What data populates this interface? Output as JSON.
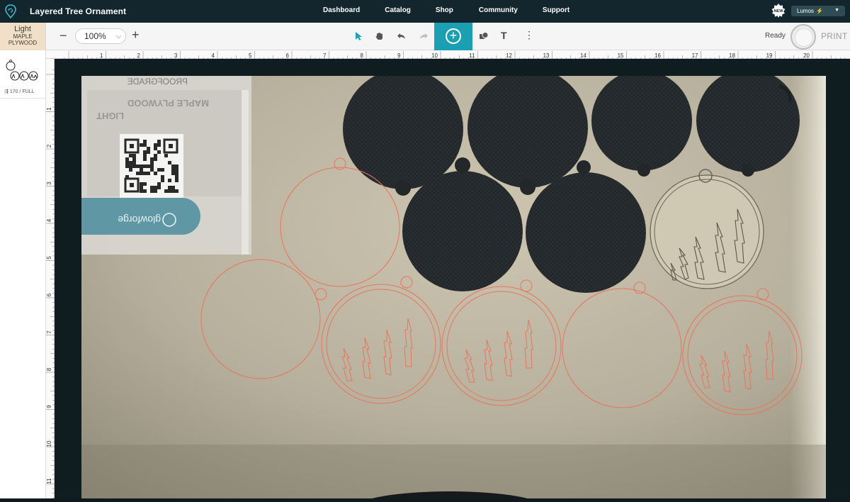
{
  "app": {
    "title": "Layered Tree Ornament",
    "nav": [
      "Dashboard",
      "Catalog",
      "Shop",
      "Community",
      "Support"
    ],
    "badge": "NEW",
    "account": "Lumos"
  },
  "toolbar": {
    "material_name": "Light",
    "material_type_line1": "MAPLE",
    "material_type_line2": "PLYWOOD",
    "zoom": "100%",
    "status": "Ready",
    "print_label": "PRINT",
    "text_tool": "T",
    "more": "⋮"
  },
  "leftpanel": {
    "setting": "170 / FULL"
  },
  "ruler": {
    "h_labels": [
      "1",
      "2",
      "3",
      "4",
      "5",
      "6",
      "7",
      "8",
      "9",
      "10",
      "11",
      "12",
      "13",
      "14",
      "15",
      "16",
      "17",
      "18",
      "19",
      "20"
    ],
    "v_labels": [
      "1",
      "2",
      "3",
      "4",
      "5",
      "6",
      "7",
      "8",
      "9",
      "10",
      "11"
    ]
  },
  "bed": {
    "card_brand": "PROOFGRADE",
    "card_line1": "LIGHT",
    "card_line2": "MAPLE PLYWOOD",
    "tag_brand": "glowforge"
  },
  "colors": {
    "accent": "#1a9fb3",
    "topbar": "#13262d",
    "material": "#f1dfc8",
    "cut_path": "#e8745e"
  }
}
